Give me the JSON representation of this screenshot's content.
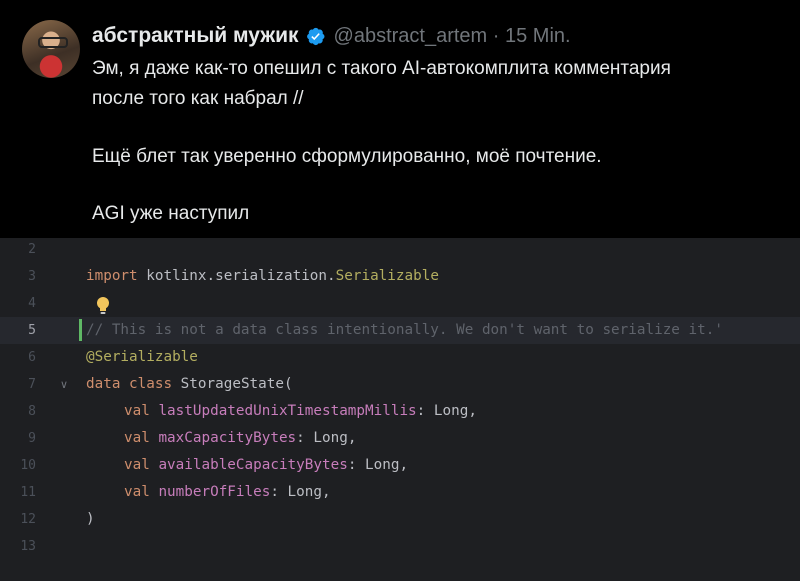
{
  "tweet": {
    "author_name": "абстрактный мужик",
    "handle_time": "@abstract_artem · 15 Min.",
    "lines": [
      "Эм, я даже как-то опешил с такого AI-автокомплита комментария",
      "после того как набрал //",
      "Ещё блет так уверенно сформулированно, моё почтение.",
      "AGI уже наступил"
    ]
  },
  "editor": {
    "line_numbers": [
      "2",
      "3",
      "4",
      "5",
      "6",
      "7",
      "8",
      "9",
      "10",
      "11",
      "12",
      "13"
    ],
    "current_line": "5",
    "code": {
      "import_kw": "import",
      "import_path": " kotlinx.serialization.",
      "import_class": "Serializable",
      "comment": "// This is not a data class intentionally. We don't want to serialize it.'",
      "annotation": "@Serializable",
      "class_kw": "data class",
      "class_name": " StorageState(",
      "props": [
        {
          "kw": "val",
          "name": "lastUpdatedUnixTimestampMillis",
          "type": ": Long,"
        },
        {
          "kw": "val",
          "name": "maxCapacityBytes",
          "type": ": Long,"
        },
        {
          "kw": "val",
          "name": "availableCapacityBytes",
          "type": ": Long,"
        },
        {
          "kw": "val",
          "name": "numberOfFiles",
          "type": ": Long,"
        }
      ],
      "close_paren": ")"
    },
    "colors": {
      "background": "#1e1f22",
      "keyword": "#cf8e6d",
      "annotation": "#b3ae60",
      "property": "#c77dbb",
      "comment": "#5f636b"
    }
  }
}
